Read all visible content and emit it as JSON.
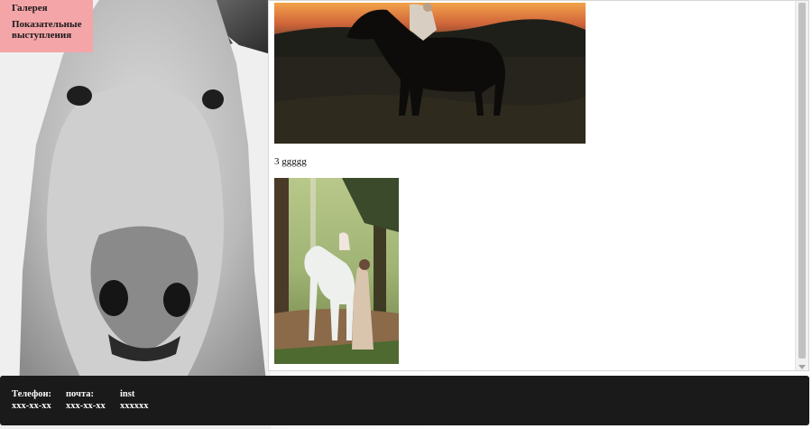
{
  "menu": {
    "items": [
      {
        "label": "Галерея"
      },
      {
        "label": "Показательные выступления"
      }
    ]
  },
  "content": {
    "photos": [
      {
        "name": "sunset-horse-rider-photo"
      },
      {
        "name": "white-horse-forest-photo"
      }
    ],
    "caption_number": "3",
    "caption_text": "ggggg"
  },
  "footer": {
    "contacts": [
      {
        "label": "Телефон:",
        "value": "xxx-xx-xx"
      },
      {
        "label": "почта:",
        "value": "xxx-xx-xx"
      },
      {
        "label": "inst",
        "value": "xxxxxx"
      }
    ]
  },
  "colors": {
    "menu_bg": "#f4a5a8",
    "footer_bg": "#1a1a1a",
    "panel_bg": "#ffffff"
  }
}
